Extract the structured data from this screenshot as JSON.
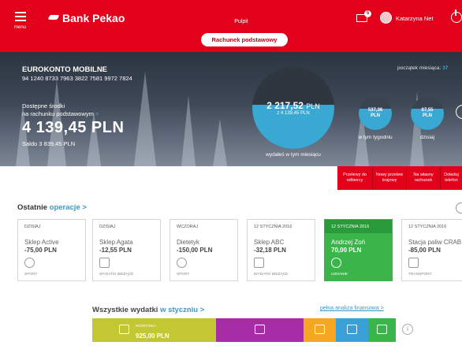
{
  "header": {
    "menu_label": "menu",
    "bank_name": "Bank Pekao",
    "page_title": "Pulpit",
    "account_button": "Rachunek podstawowy",
    "notifications_count": "5",
    "user_name": "Katarzyna Net"
  },
  "account": {
    "name": "EUROKONTO MOBILNE",
    "number": "94 1240 8733 7963 3822 7581 9972 7824",
    "available_line1": "Dostępne środki",
    "available_line2": "na rachunku podstawowym",
    "available_arrow": ">",
    "balance": "4 139,45 PLN",
    "saldo": "Saldo 3 839,45 PLN"
  },
  "spending": {
    "month_start_label": "początek miesiąca:",
    "month_start_value": "37",
    "month_amount": "2 217,52",
    "month_currency": "PLN",
    "month_sub": "z 4 139,45 PLN",
    "month_label": "wydałeś w tym miesiącu",
    "month_fraction": 0.54,
    "week_amount": "537,36",
    "week_currency": "PLN",
    "week_label": "w tym tygodniu",
    "today_amount": "87,55",
    "today_currency": "PLN",
    "today_label": "dzisiaj"
  },
  "quick_actions": [
    {
      "label": "Przelewy do odbiorcy"
    },
    {
      "label": "Nowy przelew krajowy"
    },
    {
      "label": "Na własny rachunek"
    },
    {
      "label": "Doładuj telefon"
    }
  ],
  "operations": {
    "title": "Ostatnie",
    "title_link": "operacje >",
    "items": [
      {
        "date": "DZISIAJ",
        "name": "Sklep Active",
        "amount": "-75,00 PLN",
        "category": "SPORT",
        "icon": "sport-ball-icon"
      },
      {
        "date": "DZISIAJ",
        "name": "Sklep Agata",
        "amount": "-12,55 PLN",
        "category": "WYDATKI BIEŻĄCE",
        "icon": "cards-icon"
      },
      {
        "date": "WCZORAJ",
        "name": "Dietetyk",
        "amount": "-150,00 PLN",
        "category": "SPORT",
        "icon": "sport-ball-icon"
      },
      {
        "date": "12 STYCZNIA 2016",
        "name": "Sklep ABC",
        "amount": "-32,18 PLN",
        "category": "WYDATKI BIEŻĄCE",
        "icon": "cards-icon"
      },
      {
        "date": "12 STYCZNIA 2016",
        "name": "Andrzej Zoń",
        "amount": "70,00 PLN",
        "category": "UZNANIE",
        "icon": "plus-circle-icon"
      },
      {
        "date": "12 STYCZNIA 2016",
        "name": "Stacja paliw CRAB",
        "amount": "-85,00 PLN",
        "category": "TRANSPORT",
        "icon": "transport-icon"
      }
    ]
  },
  "expenses": {
    "title": "Wszystkie wydatki",
    "title_link": "w styczniu >",
    "analysis_link": "pełna analiza finansowa >",
    "first_label": "ROZRYWKA",
    "first_value": "925,00 PLN",
    "segments": [
      {
        "color": "#c3c832",
        "share": 0.31,
        "icon": "music-icon"
      },
      {
        "color": "#a62da6",
        "share": 0.22,
        "icon": "cards-icon"
      },
      {
        "color": "#f5a623",
        "share": 0.08,
        "icon": "transport-icon"
      },
      {
        "color": "#3aa0d8",
        "share": 0.08,
        "icon": "cards-icon"
      },
      {
        "color": "#3ab54a",
        "share": 0.07,
        "icon": "home-icon"
      }
    ],
    "info_icon": "i"
  }
}
